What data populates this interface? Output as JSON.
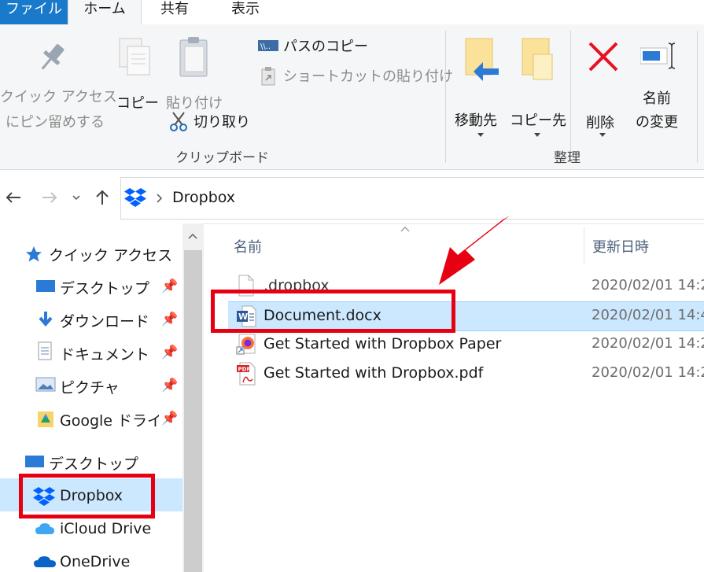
{
  "tabs": {
    "file": "ファイル",
    "home": "ホーム",
    "share": "共有",
    "view": "表示"
  },
  "ribbon": {
    "pin_label_1": "クイック アクセス",
    "pin_label_2": "にピン留めする",
    "copy": "コピー",
    "paste": "貼り付け",
    "copy_path": "パスのコピー",
    "paste_shortcut": "ショートカットの貼り付け",
    "cut": "切り取り",
    "clipboard_group": "クリップボード",
    "move_to": "移動先",
    "copy_to": "コピー先",
    "delete": "削除",
    "rename_1": "名前",
    "rename_2": "の変更",
    "organize_group": "整理"
  },
  "address": {
    "path": "Dropbox"
  },
  "sidebar": {
    "quick_access": "クイック アクセス",
    "items": [
      "デスクトップ",
      "ダウンロード",
      "ドキュメント",
      "ピクチャ",
      "Google ドライブ"
    ],
    "desktop": "デスクトップ",
    "dropbox": "Dropbox",
    "icloud": "iCloud Drive",
    "onedrive": "OneDrive"
  },
  "columns": {
    "name": "名前",
    "date": "更新日時"
  },
  "files": [
    {
      "name": ".dropbox",
      "date": "2020/02/01 14:2"
    },
    {
      "name": "Document.docx",
      "date": "2020/02/01 14:4"
    },
    {
      "name": "Get Started with Dropbox Paper",
      "date": "2020/02/01 14:2"
    },
    {
      "name": "Get Started with Dropbox.pdf",
      "date": "2020/02/01 14:2"
    }
  ],
  "colors": {
    "accent": "#1979ca",
    "highlight": "#e60012",
    "selected_row": "#cce8ff"
  }
}
